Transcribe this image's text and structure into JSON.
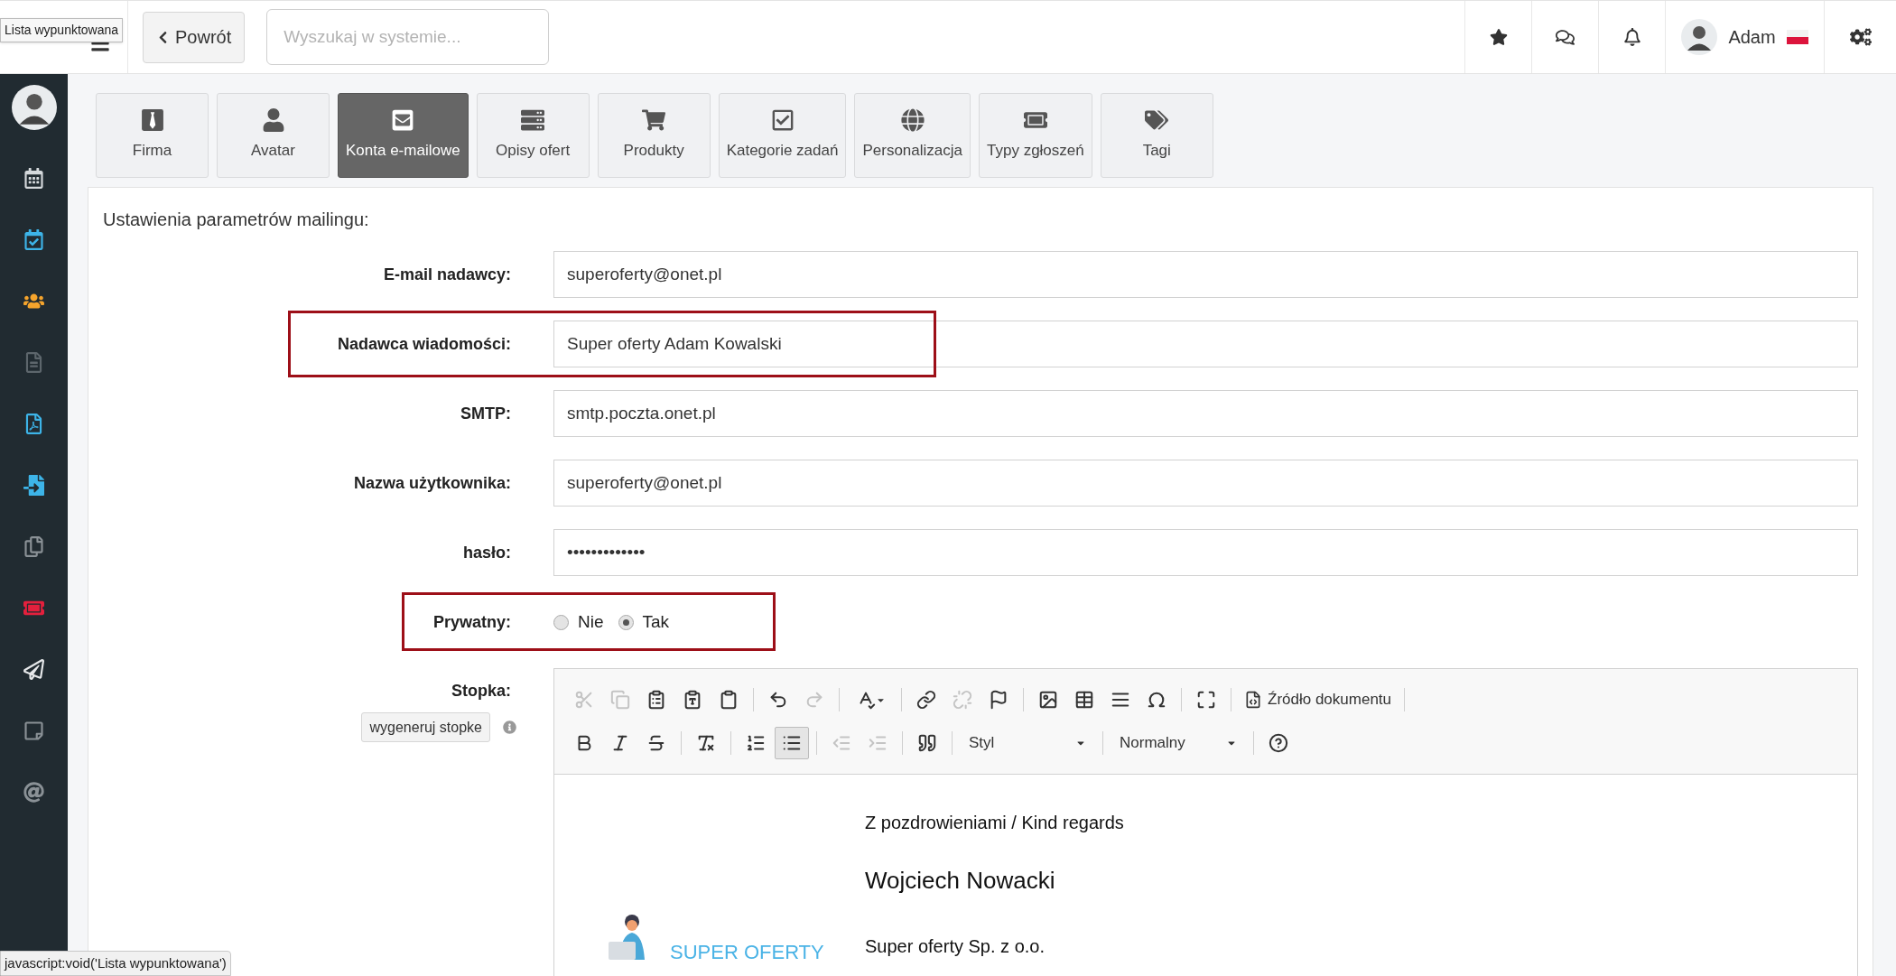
{
  "top_bar": {
    "tooltip": "Lista wypunktowana",
    "back_button": "Powrót",
    "search": {
      "placeholder": "Wyszukaj w systemie..."
    },
    "user": {
      "name": "Adam"
    }
  },
  "sidebar": {
    "items": [
      {
        "color": "#d5d9dc"
      },
      {
        "color": "#3db4e8"
      },
      {
        "color": "#f5a42c"
      },
      {
        "color": "#5d666c"
      },
      {
        "color": "#3db4e8"
      },
      {
        "color": "#3db4e8"
      },
      {
        "color": "#8a9196"
      },
      {
        "color": "#e4203d"
      },
      {
        "color": "#e6e8ea"
      },
      {
        "color": "#8a9196"
      },
      {
        "color": "#8a9196"
      }
    ]
  },
  "tabs": [
    {
      "label": "Firma",
      "selected": false
    },
    {
      "label": "Avatar",
      "selected": false
    },
    {
      "label": "Konta e-mailowe",
      "selected": true
    },
    {
      "label": "Opisy ofert",
      "selected": false
    },
    {
      "label": "Produkty",
      "selected": false
    },
    {
      "label": "Kategorie zadań",
      "selected": false
    },
    {
      "label": "Personalizacja",
      "selected": false
    },
    {
      "label": "Typy zgłoszeń",
      "selected": false
    },
    {
      "label": "Tagi",
      "selected": false
    }
  ],
  "panel": {
    "heading": "Ustawienia parametrów mailingu:",
    "fields": [
      {
        "label": "E-mail nadawcy:",
        "value": "superoferty@onet.pl",
        "highlighted": false
      },
      {
        "label": "Nadawca wiadomości:",
        "value": "Super oferty Adam Kowalski",
        "highlighted": true
      },
      {
        "label": "SMTP:",
        "value": "smtp.poczta.onet.pl",
        "highlighted": false
      },
      {
        "label": "Nazwa użytkownika:",
        "value": "superoferty@onet.pl",
        "highlighted": false
      },
      {
        "label": "hasło:",
        "value": "•••••••••••••",
        "highlighted": false
      }
    ],
    "private": {
      "label": "Prywatny:",
      "highlighted": true,
      "options": [
        {
          "label": "Nie",
          "selected": false
        },
        {
          "label": "Tak",
          "selected": true
        }
      ]
    },
    "footer": {
      "label": "Stopka:",
      "generate_button": "wygeneruj stopke",
      "editor": {
        "toolbar": [
          [
            {
              "kind": "button",
              "disabled": true,
              "active": false
            },
            {
              "kind": "button",
              "disabled": true,
              "active": false
            },
            {
              "kind": "button",
              "disabled": false,
              "active": false
            },
            {
              "kind": "button",
              "disabled": false,
              "active": false
            },
            {
              "kind": "button",
              "disabled": false,
              "active": false
            },
            {
              "kind": "separator"
            },
            {
              "kind": "button",
              "disabled": false,
              "active": false
            },
            {
              "kind": "button",
              "disabled": true,
              "active": false
            },
            {
              "kind": "separator"
            },
            {
              "kind": "button",
              "disabled": false,
              "active": false
            },
            {
              "kind": "separator"
            },
            {
              "kind": "button",
              "disabled": false,
              "active": false
            },
            {
              "kind": "button",
              "disabled": true,
              "active": false
            },
            {
              "kind": "button",
              "disabled": false,
              "active": false
            },
            {
              "kind": "separator"
            },
            {
              "kind": "button",
              "disabled": false,
              "active": false
            },
            {
              "kind": "button",
              "disabled": false,
              "active": false
            },
            {
              "kind": "button",
              "disabled": false,
              "active": false
            },
            {
              "kind": "button",
              "disabled": false,
              "active": false
            },
            {
              "kind": "separator"
            },
            {
              "kind": "button",
              "disabled": false,
              "active": false
            },
            {
              "kind": "separator"
            },
            {
              "kind": "text-button",
              "label": "Źródło dokumentu"
            },
            {
              "kind": "separator"
            }
          ],
          [
            {
              "kind": "button",
              "disabled": false,
              "active": false
            },
            {
              "kind": "button",
              "disabled": false,
              "active": false
            },
            {
              "kind": "button",
              "disabled": false,
              "active": false
            },
            {
              "kind": "separator"
            },
            {
              "kind": "button",
              "disabled": false,
              "active": false
            },
            {
              "kind": "separator"
            },
            {
              "kind": "button",
              "disabled": false,
              "active": false
            },
            {
              "kind": "button",
              "disabled": false,
              "active": true
            },
            {
              "kind": "separator"
            },
            {
              "kind": "button",
              "disabled": true,
              "active": false
            },
            {
              "kind": "button",
              "disabled": true,
              "active": false
            },
            {
              "kind": "separator"
            },
            {
              "kind": "button",
              "disabled": false,
              "active": false
            },
            {
              "kind": "separator"
            },
            {
              "kind": "dropdown",
              "label": "Styl"
            },
            {
              "kind": "separator"
            },
            {
              "kind": "dropdown",
              "label": "Normalny"
            },
            {
              "kind": "separator"
            },
            {
              "kind": "button",
              "disabled": false,
              "active": false
            }
          ]
        ],
        "content": {
          "greeting": "Z pozdrowieniami / Kind regards",
          "name": "Wojciech Nowacki",
          "company": "Super oferty Sp. z o.o.",
          "logo_text": "SUPER OFERTY"
        }
      }
    }
  },
  "status_bar": "javascript:void('Lista wypunktowana')"
}
